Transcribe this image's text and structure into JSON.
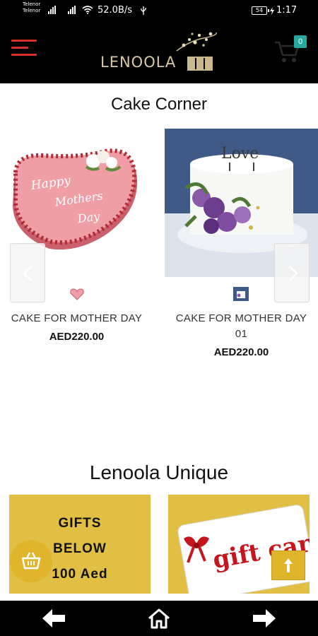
{
  "status_bar": {
    "carrier_1": "Telenor",
    "carrier_2": "Telenor",
    "speed": "52.0B/s",
    "battery": "54",
    "time": "1:17"
  },
  "header": {
    "logo_text": "LENOOLA",
    "cart_count": "0"
  },
  "cake_corner": {
    "title": "Cake Corner",
    "products": [
      {
        "name": "CAKE FOR MOTHER DAY",
        "price": "AED220.00"
      },
      {
        "name_line1": "CAKE FOR MOTHER DAY",
        "name_line2": "01",
        "price": "AED220.00"
      }
    ]
  },
  "unique": {
    "title": "Lenoola Unique",
    "tile_1": {
      "line1": "GIFTS",
      "line2": "BELOW",
      "line3": "100 Aed"
    },
    "tile_2": {
      "card_text": "gift card"
    }
  },
  "colors": {
    "bar": "#000000",
    "menu_accent": "#d9302c",
    "badge": "#27a7a0",
    "gold": "#e0bf44"
  },
  "icons": [
    "menu-icon",
    "cart-icon",
    "chevron-left-icon",
    "chevron-right-icon",
    "basket-icon",
    "arrow-up-icon",
    "back-arrow-icon",
    "home-icon",
    "forward-arrow-icon"
  ]
}
